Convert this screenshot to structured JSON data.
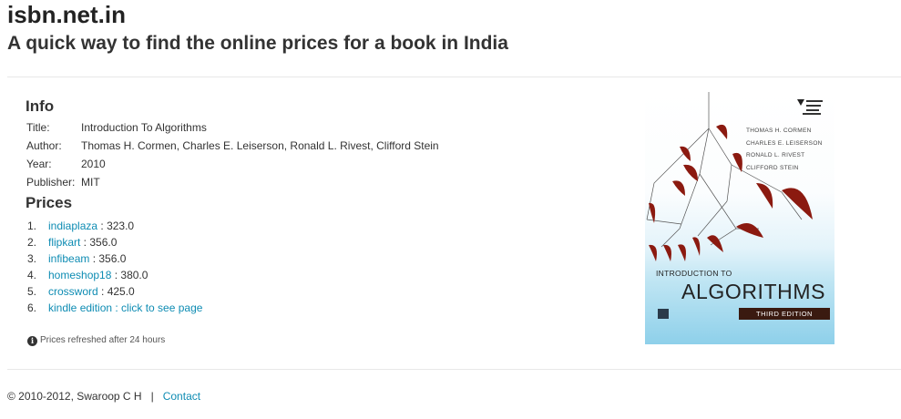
{
  "header": {
    "site_title": "isbn.net.in",
    "tagline": "A quick way to find the online prices for a book in India"
  },
  "info": {
    "heading": "Info",
    "rows": [
      {
        "label": "Title:",
        "value": "Introduction To Algorithms"
      },
      {
        "label": "Author:",
        "value": "Thomas H. Cormen, Charles E. Leiserson, Ronald L. Rivest, Clifford Stein"
      },
      {
        "label": "Year:",
        "value": "2010"
      },
      {
        "label": "Publisher:",
        "value": "MIT"
      }
    ]
  },
  "prices": {
    "heading": "Prices",
    "items": [
      {
        "num": "1.",
        "store": "indiaplaza",
        "sep": " : ",
        "price": "323.0"
      },
      {
        "num": "2.",
        "store": "flipkart",
        "sep": " : ",
        "price": "356.0"
      },
      {
        "num": "3.",
        "store": "infibeam",
        "sep": " : ",
        "price": "356.0"
      },
      {
        "num": "4.",
        "store": "homeshop18",
        "sep": " : ",
        "price": "380.0"
      },
      {
        "num": "5.",
        "store": "crossword",
        "sep": " : ",
        "price": "425.0"
      },
      {
        "num": "6.",
        "store": "kindle edition : click to see page"
      }
    ],
    "refresh_note": "Prices refreshed after 24 hours"
  },
  "cover": {
    "authors": [
      "THOMAS H. CORMEN",
      "CHARLES E. LEISERSON",
      "RONALD L. RIVEST",
      "CLIFFORD STEIN"
    ],
    "intro": "INTRODUCTION TO",
    "title": "ALGORITHMS",
    "edition": "THIRD EDITION"
  },
  "footer": {
    "copyright": "© 2010-2012, Swaroop C H",
    "separator": "|",
    "contact_label": "Contact"
  },
  "colors": {
    "link": "#0e8cb3",
    "mobile_dark_red": "#8b1a10"
  },
  "icons": {
    "info": "info-circle-icon"
  }
}
